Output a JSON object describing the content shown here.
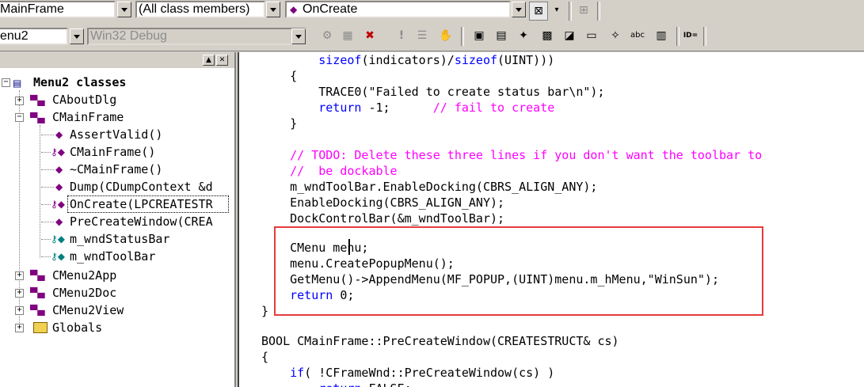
{
  "toolbar1": {
    "class_combo": "MainFrame",
    "filter_combo": "(All class members)",
    "member_combo": "OnCreate"
  },
  "toolbar2": {
    "project_combo": "enu2",
    "config_combo": "Win32 Debug",
    "id_label": "ID="
  },
  "tree": {
    "root": "Menu2 classes",
    "items": [
      {
        "label": "CAboutDlg",
        "kind": "class"
      },
      {
        "label": "CMainFrame",
        "kind": "class"
      },
      {
        "label": "AssertValid()",
        "kind": "method"
      },
      {
        "label": "CMainFrame()",
        "kind": "protected-method"
      },
      {
        "label": "~CMainFrame()",
        "kind": "method"
      },
      {
        "label": "Dump(CDumpContext &d",
        "kind": "method"
      },
      {
        "label": "OnCreate(LPCREATESTR",
        "kind": "protected-method"
      },
      {
        "label": "PreCreateWindow(CREA",
        "kind": "method"
      },
      {
        "label": "m_wndStatusBar",
        "kind": "variable"
      },
      {
        "label": "m_wndToolBar",
        "kind": "variable"
      },
      {
        "label": "CMenu2App",
        "kind": "class"
      },
      {
        "label": "CMenu2Doc",
        "kind": "class"
      },
      {
        "label": "CMenu2View",
        "kind": "class"
      },
      {
        "label": "Globals",
        "kind": "folder"
      }
    ]
  },
  "code": {
    "lines": [
      "        sizeof(indicators)/sizeof(UINT)))",
      "    {",
      "        TRACE0(\"Failed to create status bar\\n\");",
      "        return -1;      // fail to create",
      "    }",
      "",
      "    // TODO: Delete these three lines if you don't want the toolbar to",
      "    //  be dockable",
      "    m_wndToolBar.EnableDocking(CBRS_ALIGN_ANY);",
      "    EnableDocking(CBRS_ALIGN_ANY);",
      "    DockControlBar(&m_wndToolBar);",
      "",
      "    CMenu menu;",
      "    menu.CreatePopupMenu();",
      "    GetMenu()->AppendMenu(MF_POPUP,(UINT)menu.m_hMenu,\"WinSun\");",
      "    return 0;",
      "}",
      "",
      "BOOL CMainFrame::PreCreateWindow(CREATESTRUCT& cs)",
      "{",
      "    if( !CFrameWnd::PreCreateWindow(cs) )",
      "        return FALSE;"
    ]
  },
  "colors": {
    "keyword": "#0000ff",
    "comment": "#ff00ff",
    "highlight_box": "#e63c3c"
  }
}
